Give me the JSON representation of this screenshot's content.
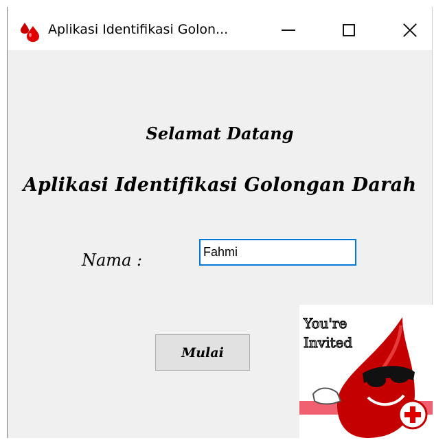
{
  "window": {
    "title": "Aplikasi Identifikasi Golon...",
    "app_icon": "blood-drops-icon",
    "controls": [
      "minimize-icon",
      "maximize-icon",
      "close-icon"
    ]
  },
  "main": {
    "welcome": "Selamat Datang",
    "app_title": "Aplikasi Identifikasi Golongan Darah",
    "name_label": "Nama :",
    "name_value": "Fahmi ",
    "start_button": "Mulai"
  },
  "promo_image": {
    "line1": "You're",
    "line2": "Invited",
    "icon": "red-cross-icon"
  },
  "colors": {
    "accent": "#0078d7",
    "blood_red": "#d40000",
    "window_bg": "#f0f0f0"
  }
}
